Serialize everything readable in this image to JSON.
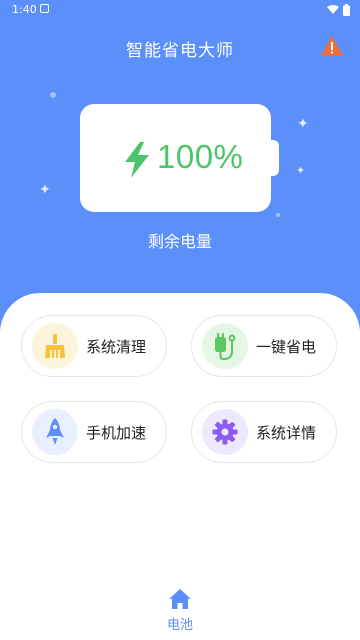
{
  "status_bar": {
    "time": "1:40"
  },
  "app": {
    "title": "智能省电大师"
  },
  "battery": {
    "percent_text": "100%",
    "label": "剩余电量"
  },
  "actions": [
    {
      "label": "系统清理",
      "icon": "broom-icon",
      "icon_color": "#f4c23c",
      "bg": "#fdf4dc"
    },
    {
      "label": "一键省电",
      "icon": "plug-icon",
      "icon_color": "#5cc65f",
      "bg": "#e4f6e4"
    },
    {
      "label": "手机加速",
      "icon": "rocket-icon",
      "icon_color": "#5b8ff9",
      "bg": "#e8efff"
    },
    {
      "label": "系统详情",
      "icon": "gear-icon",
      "icon_color": "#8b5cf6",
      "bg": "#efe9ff"
    }
  ],
  "bottom_nav": {
    "active_label": "电池"
  },
  "colors": {
    "primary": "#5b8ff9",
    "battery_green": "#4cc46a",
    "warning": "#f26b3a"
  }
}
